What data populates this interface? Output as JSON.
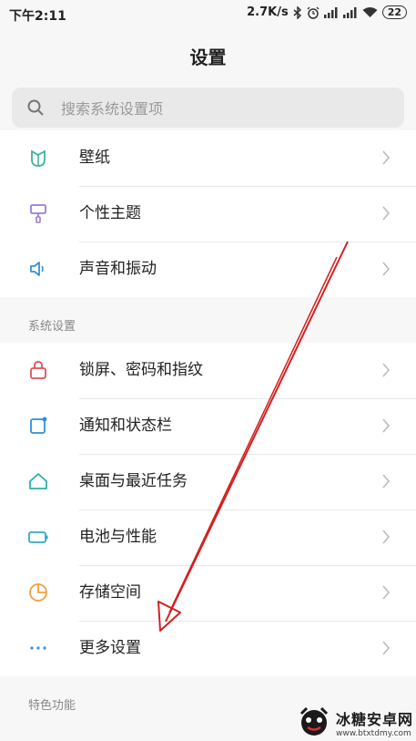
{
  "status_bar": {
    "time": "下午2:11",
    "net_speed": "2.7K/s",
    "battery": "22",
    "icons": [
      "bluetooth-icon",
      "alarm-icon",
      "signal-icon",
      "signal-icon",
      "wifi-icon",
      "battery-icon"
    ]
  },
  "header": {
    "title": "设置"
  },
  "search": {
    "placeholder": "搜索系统设置项"
  },
  "top_items": [
    {
      "label": "壁纸",
      "icon": "wallpaper-icon",
      "color": "#3bb39b"
    },
    {
      "label": "个性主题",
      "icon": "theme-brush-icon",
      "color": "#9a7bd8"
    },
    {
      "label": "声音和振动",
      "icon": "speaker-icon",
      "color": "#3a8fd8"
    }
  ],
  "system_section": {
    "title": "系统设置",
    "items": [
      {
        "label": "锁屏、密码和指纹",
        "icon": "lock-icon",
        "color": "#e0505a"
      },
      {
        "label": "通知和状态栏",
        "icon": "notification-icon",
        "color": "#2f8fd8"
      },
      {
        "label": "桌面与最近任务",
        "icon": "home-icon",
        "color": "#2ab0a8"
      },
      {
        "label": "电池与性能",
        "icon": "battery-icon",
        "color": "#2fa9c8"
      },
      {
        "label": "存储空间",
        "icon": "storage-pie-icon",
        "color": "#f0a040"
      },
      {
        "label": "更多设置",
        "icon": "more-dots-icon",
        "color": "#3a8fd8"
      }
    ]
  },
  "features_section": {
    "title": "特色功能"
  },
  "watermark": {
    "name": "冰糖安卓网",
    "url": "www.btxtdmy.com"
  },
  "annotation": {
    "color": "#d42020"
  }
}
